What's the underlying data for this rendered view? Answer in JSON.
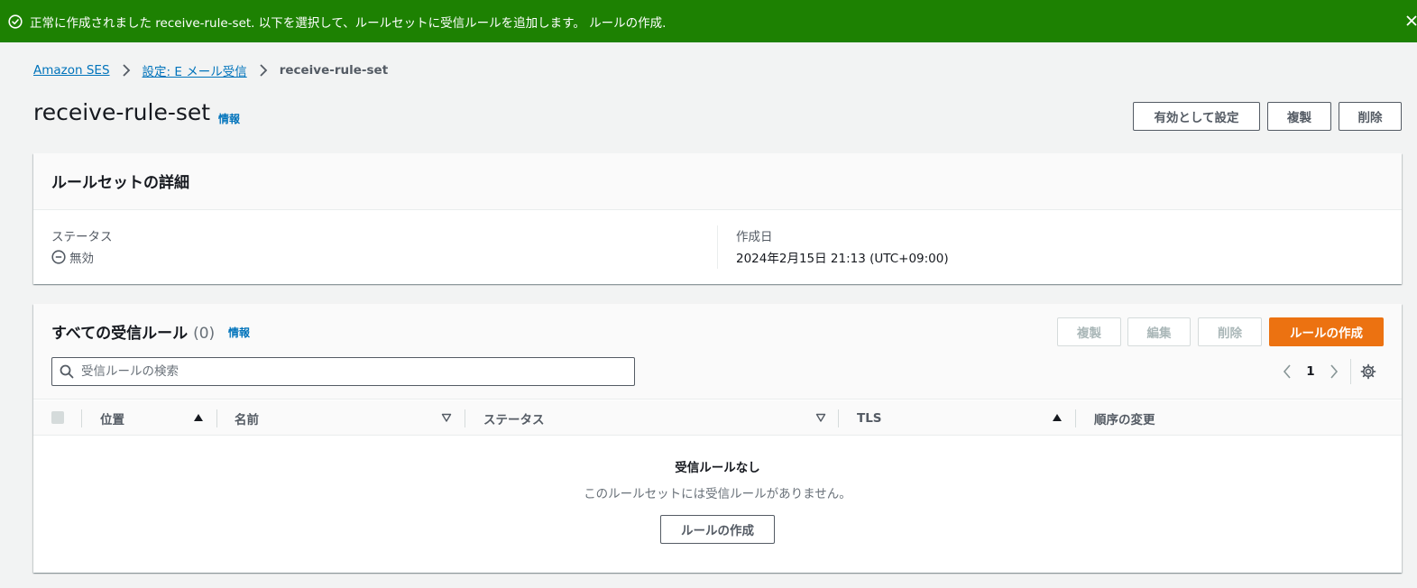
{
  "flash": {
    "message": "正常に作成されました receive-rule-set. 以下を選択して、ルールセットに受信ルールを追加します。 ルールの作成.",
    "success_color": "#1d8102"
  },
  "breadcrumb": {
    "items": [
      "Amazon SES",
      "設定: E メール受信"
    ],
    "current": "receive-rule-set"
  },
  "page": {
    "title": "receive-rule-set",
    "info": "情報",
    "actions": {
      "set_active": "有効として設定",
      "duplicate": "複製",
      "delete": "削除"
    }
  },
  "details": {
    "title": "ルールセットの詳細",
    "status_label": "ステータス",
    "status_value": "無効",
    "created_label": "作成日",
    "created_value": "2024年2月15日 21:13 (UTC+09:00)"
  },
  "rules": {
    "title": "すべての受信ルール",
    "count": "(0)",
    "info": "情報",
    "actions": {
      "duplicate": "複製",
      "edit": "編集",
      "delete": "削除",
      "create": "ルールの作成"
    },
    "search_placeholder": "受信ルールの検索",
    "page_number": "1",
    "columns": {
      "position": "位置",
      "name": "名前",
      "status": "ステータス",
      "tls": "TLS",
      "reorder": "順序の変更"
    },
    "empty": {
      "title": "受信ルールなし",
      "message": "このルールセットには受信ルールがありません。",
      "create_button": "ルールの作成"
    },
    "primary_color": "#ec7211"
  }
}
